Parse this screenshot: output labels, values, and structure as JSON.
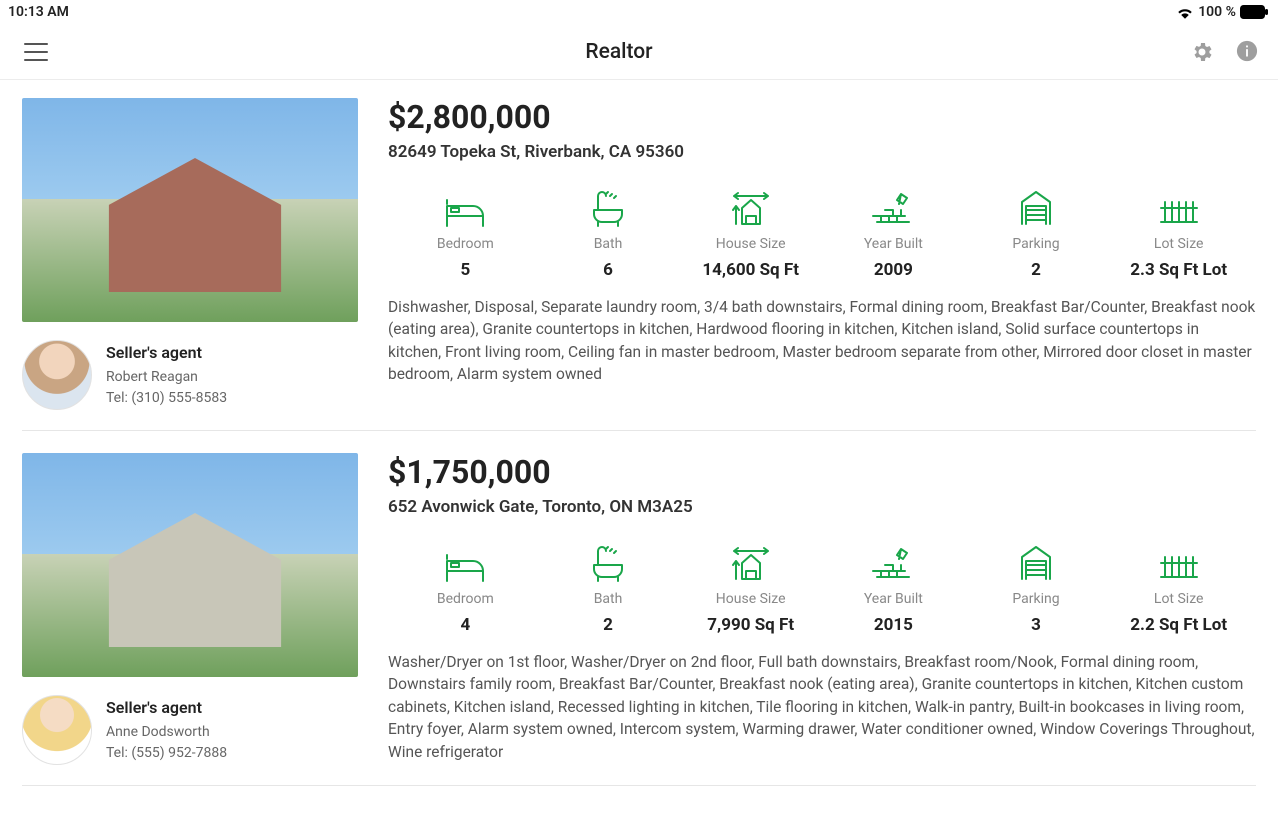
{
  "status": {
    "time": "10:13 AM",
    "battery": "100 %"
  },
  "app": {
    "title": "Realtor"
  },
  "agent_label": "Seller's agent",
  "stat_labels": {
    "bedroom": "Bedroom",
    "bath": "Bath",
    "house_size": "House Size",
    "year_built": "Year Built",
    "parking": "Parking",
    "lot_size": "Lot Size"
  },
  "listings": [
    {
      "price": "$2,800,000",
      "address": "82649 Topeka St, Riverbank, CA 95360",
      "agent": {
        "name": "Robert Reagan",
        "tel": "Tel: (310) 555-8583"
      },
      "stats": {
        "bedroom": "5",
        "bath": "6",
        "house_size": "14,600 Sq Ft",
        "year_built": "2009",
        "parking": "2",
        "lot_size": "2.3 Sq Ft Lot"
      },
      "description": "Dishwasher, Disposal, Separate laundry room, 3/4 bath downstairs, Formal dining room, Breakfast Bar/Counter, Breakfast nook (eating area), Granite countertops in kitchen, Hardwood flooring in kitchen, Kitchen island, Solid surface countertops in kitchen, Front living room, Ceiling fan in master bedroom, Master bedroom separate from other, Mirrored door closet in master bedroom, Alarm system owned"
    },
    {
      "price": "$1,750,000",
      "address": "652 Avonwick Gate, Toronto, ON M3A25",
      "agent": {
        "name": "Anne Dodsworth",
        "tel": "Tel: (555) 952-7888"
      },
      "stats": {
        "bedroom": "4",
        "bath": "2",
        "house_size": "7,990 Sq Ft",
        "year_built": "2015",
        "parking": "3",
        "lot_size": "2.2 Sq Ft Lot"
      },
      "description": "Washer/Dryer on 1st floor, Washer/Dryer on 2nd floor, Full bath downstairs, Breakfast room/Nook, Formal dining room, Downstairs family room, Breakfast Bar/Counter, Breakfast nook (eating area), Granite countertops in kitchen, Kitchen custom cabinets, Kitchen island, Recessed lighting in kitchen, Tile flooring in kitchen, Walk-in pantry, Built-in bookcases in living room, Entry foyer, Alarm system owned, Intercom system, Warming drawer, Water conditioner owned, Window Coverings Throughout, Wine refrigerator"
    }
  ]
}
